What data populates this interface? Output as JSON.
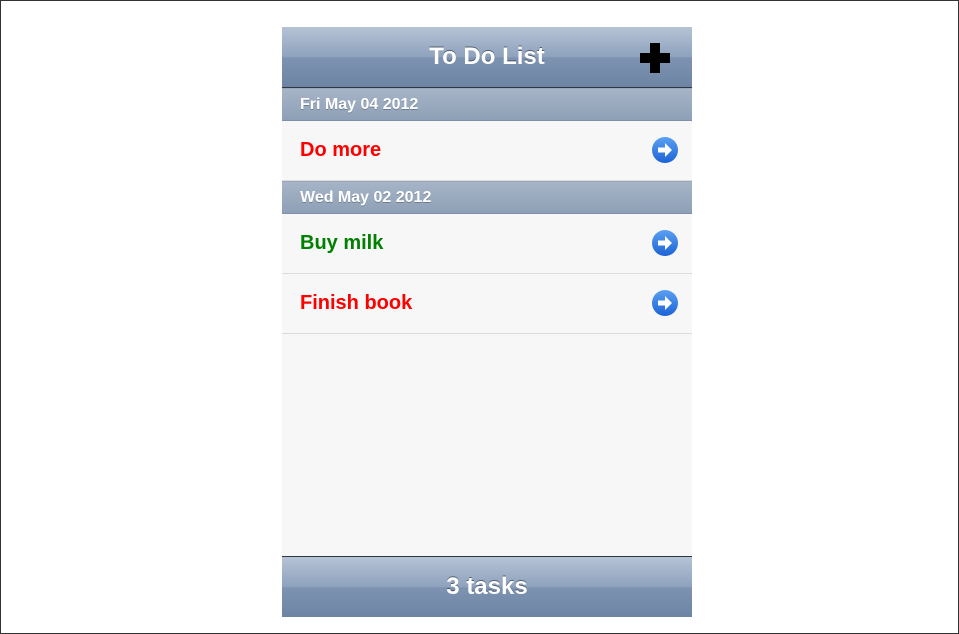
{
  "navbar": {
    "title": "To Do List",
    "add_icon": "plus-icon"
  },
  "sections": [
    {
      "header": "Fri May 04 2012",
      "items": [
        {
          "label": "Do more",
          "color": "#ff0000",
          "accessory_icon": "disclosure-arrow-icon"
        }
      ]
    },
    {
      "header": "Wed May 02 2012",
      "items": [
        {
          "label": "Buy milk",
          "color": "#008000",
          "accessory_icon": "disclosure-arrow-icon"
        },
        {
          "label": "Finish book",
          "color": "#ff0000",
          "accessory_icon": "disclosure-arrow-icon"
        }
      ]
    }
  ],
  "footer": {
    "label": "3 tasks"
  },
  "colors": {
    "bar": "#7d93b1",
    "section_header": "#97a7bc",
    "disclosure": "#2f7be0",
    "row_background": "#f7f7f7"
  }
}
